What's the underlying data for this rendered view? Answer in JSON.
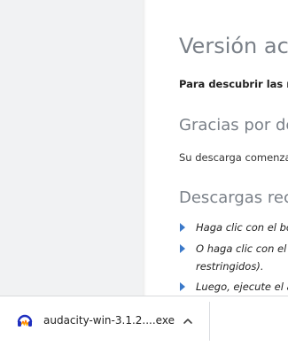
{
  "content": {
    "heading": "Versión act",
    "lead": "Para descubrir las n",
    "thanks_heading": "Gracias por de",
    "download_started": "Su descarga comenza",
    "recommended_heading": "Descargas reco",
    "bullets": [
      "Haga clic con el bo",
      "O haga clic con el b",
      "restringidos).",
      "Luego, ejecute el a"
    ],
    "accent_color": "#3b79c9"
  },
  "download_bar": {
    "filename": "audacity-win-3.1.2....exe",
    "icon": "audacity-icon",
    "menu_icon": "chevron-up-icon"
  }
}
